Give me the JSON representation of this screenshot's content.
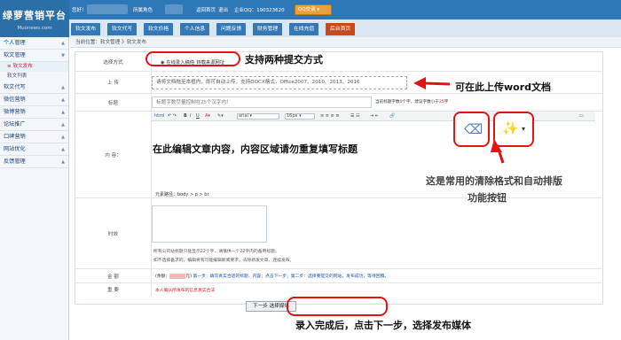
{
  "logo": {
    "title": "绿萝营销平台",
    "domain": "Muonews.com"
  },
  "topbar": {
    "hello": "您好！",
    "role_label": "所属角色",
    "return_home": "返回首页",
    "exit": "退出",
    "company_qq": "企业QQ：190323620",
    "qq_btn": "QQ交谈"
  },
  "nav_tabs": [
    "软文发布",
    "软文代写",
    "软文价格",
    "个人信息",
    "问题反馈",
    "财务管理",
    "在线充值",
    "后台首页"
  ],
  "sidebar": [
    {
      "label": "个人管理",
      "caret": "▲"
    },
    {
      "label": "软文管理",
      "caret": "▼",
      "children": [
        "软文发布",
        "软文列表"
      ]
    },
    {
      "label": "软文代写",
      "caret": "▲"
    },
    {
      "label": "微信营销",
      "caret": "▲"
    },
    {
      "label": "微博营销",
      "caret": "▲"
    },
    {
      "label": "论坛推广",
      "caret": "▲"
    },
    {
      "label": "口碑营销",
      "caret": "▲"
    },
    {
      "label": "网站优化",
      "caret": "▲"
    },
    {
      "label": "反馈管理",
      "caret": "▲"
    }
  ],
  "breadcrumb": "当前位置：软文管理 》软文发布",
  "form": {
    "method_label": "选择方式",
    "radio1": "在线录入稿件",
    "radio2": "转载来源网址",
    "upload_label": "上 传",
    "upload_text": "请将文档拖至本框内，即可自动上传，支持DOCX格式，Office2007、2010、2013、2016",
    "title_label": "标题",
    "title_placeholder": "标题字数尽量控制在25个汉字内！",
    "title_hint_a": "当前标题字数",
    "title_hint_b": "个字，建议字数小于",
    "title_hint_num": "25",
    "title_hint_c": "字",
    "content_label": "内 容：",
    "editor_font": "arial",
    "editor_size": "16px",
    "element_path": "元素路径：body > p > br",
    "time_label": "时效",
    "time_note1": "所有公司站标题只能显示22个字，请慎供一个22字内的备用标题。",
    "time_note2": "如不选择备求的，编辑将有可能编辑新闻要求，去除新发文章，连续发布。",
    "amount_label": "金 额",
    "amount_left": "(余额：",
    "amount_right": "元)",
    "amount_step": "第一步：填写真实合适的标题、内容；点击下一步；第二步：选择要提交的网站，发布成功，等待回稿。",
    "important_label": "重 要",
    "important_text": "本人确认所发布的信息真实合法",
    "next_btn": "下一步 选择媒体"
  },
  "annotations": {
    "a1": "支持两种提交方式",
    "a2": "可在此上传word文档",
    "a3": "在此编辑文章内容，内容区域请勿重复填写标题",
    "a4_line1": "这是常用的清除格式和自动排版",
    "a4_line2": "功能按钮",
    "a5": "录入完成后，点击下一步，选择发布媒体"
  },
  "colors": {
    "header_blue": "#2e78b8",
    "annotation_red": "#e11414",
    "active_tab": "#c84a1b"
  },
  "icons": [
    "eraser-icon",
    "magic-wand-icon",
    "chevron-down-icon",
    "arrow-icon"
  ]
}
